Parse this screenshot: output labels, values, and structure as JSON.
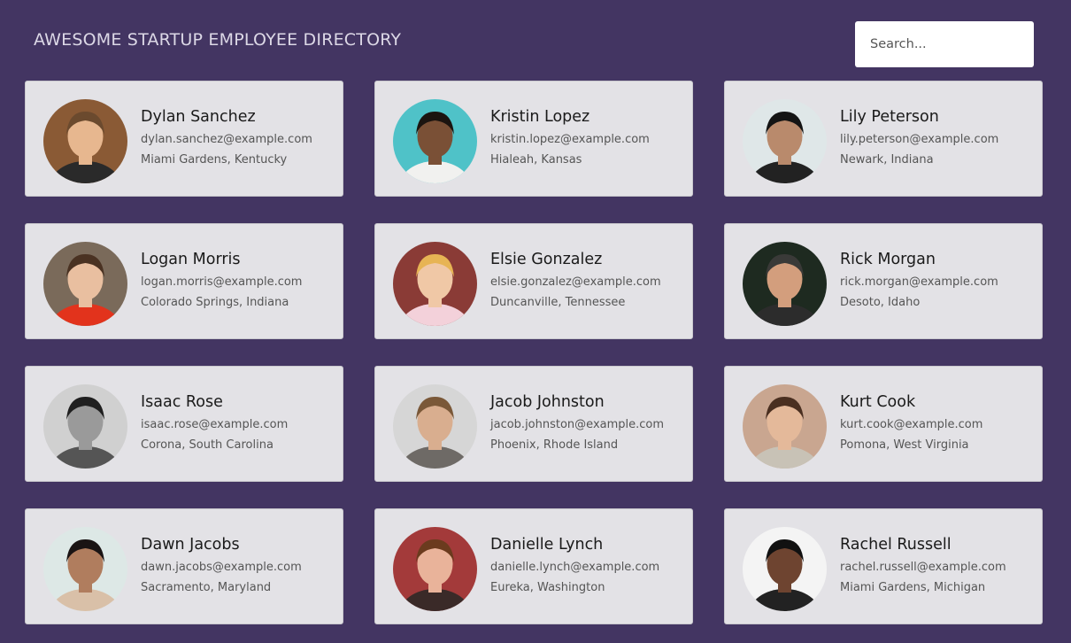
{
  "header": {
    "title": "AWESOME STARTUP EMPLOYEE DIRECTORY",
    "search_placeholder": "Search..."
  },
  "employees": [
    {
      "name": "Dylan Sanchez",
      "email": "dylan.sanchez@example.com",
      "location": "Miami Gardens, Kentucky",
      "bg": "#8a5a35",
      "skin": "#e7b78f",
      "hair": "#6b4a2e",
      "shirt": "#2a2a2a"
    },
    {
      "name": "Kristin Lopez",
      "email": "kristin.lopez@example.com",
      "location": "Hialeah, Kansas",
      "bg": "#4fc2c8",
      "skin": "#7a5036",
      "hair": "#1b1410",
      "shirt": "#f1f1ef"
    },
    {
      "name": "Lily Peterson",
      "email": "lily.peterson@example.com",
      "location": "Newark, Indiana",
      "bg": "#dfe7e8",
      "skin": "#b98a6c",
      "hair": "#141414",
      "shirt": "#222222"
    },
    {
      "name": "Logan Morris",
      "email": "logan.morris@example.com",
      "location": "Colorado Springs, Indiana",
      "bg": "#7a6a5a",
      "skin": "#e9bfa0",
      "hair": "#4a3222",
      "shirt": "#e2331c"
    },
    {
      "name": "Elsie Gonzalez",
      "email": "elsie.gonzalez@example.com",
      "location": "Duncanville, Tennessee",
      "bg": "#8a3b36",
      "skin": "#f0c8a6",
      "hair": "#e7b454",
      "shirt": "#f3d1da"
    },
    {
      "name": "Rick Morgan",
      "email": "rick.morgan@example.com",
      "location": "Desoto, Idaho",
      "bg": "#1e2a20",
      "skin": "#d39e7d",
      "hair": "#3a3a38",
      "shirt": "#2c2c2c"
    },
    {
      "name": "Isaac Rose",
      "email": "isaac.rose@example.com",
      "location": "Corona, South Carolina",
      "bg": "#d0d0d0",
      "skin": "#9a9a9a",
      "hair": "#1f1f1f",
      "shirt": "#555555"
    },
    {
      "name": "Jacob Johnston",
      "email": "jacob.johnston@example.com",
      "location": "Phoenix, Rhode Island",
      "bg": "#d6d6d6",
      "skin": "#d9ae8f",
      "hair": "#7a5838",
      "shirt": "#6e6a66"
    },
    {
      "name": "Kurt Cook",
      "email": "kurt.cook@example.com",
      "location": "Pomona, West Virginia",
      "bg": "#c9a690",
      "skin": "#e4b99a",
      "hair": "#4a2f20",
      "shirt": "#c8c2b6"
    },
    {
      "name": "Dawn Jacobs",
      "email": "dawn.jacobs@example.com",
      "location": "Sacramento, Maryland",
      "bg": "#dde8e6",
      "skin": "#b07d5e",
      "hair": "#1a1414",
      "shirt": "#d9c0a8"
    },
    {
      "name": "Danielle Lynch",
      "email": "danielle.lynch@example.com",
      "location": "Eureka, Washington",
      "bg": "#a33a3a",
      "skin": "#e9b39a",
      "hair": "#6b3b1e",
      "shirt": "#3a2a28"
    },
    {
      "name": "Rachel Russell",
      "email": "rachel.russell@example.com",
      "location": "Miami Gardens, Michigan",
      "bg": "#f4f4f4",
      "skin": "#6e4430",
      "hair": "#111111",
      "shirt": "#222222"
    }
  ]
}
